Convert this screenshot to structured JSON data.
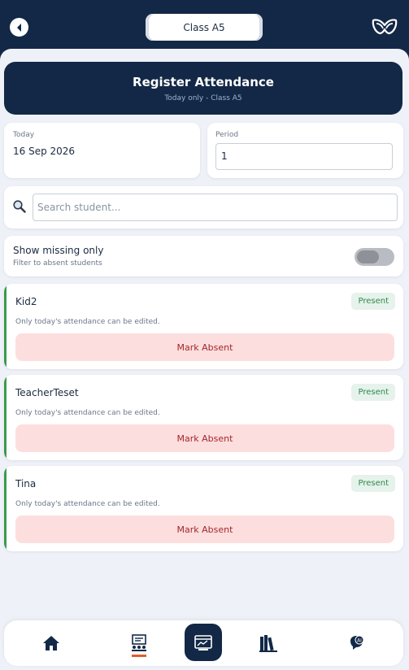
{
  "header": {
    "class_selector": "Class A5"
  },
  "hero": {
    "title": "Register Attendance",
    "subtitle": "Today only - Class A5"
  },
  "date_card": {
    "label": "Today",
    "value": "16 Sep 2026"
  },
  "period_card": {
    "label": "Period",
    "value": "1"
  },
  "search": {
    "placeholder": "Search student..."
  },
  "filter": {
    "title": "Show missing only",
    "subtitle": "Filter to absent students",
    "enabled": false
  },
  "students": [
    {
      "name": "Kid2",
      "status": "Present",
      "note": "Only today's attendance can be edited.",
      "action": "Mark Absent"
    },
    {
      "name": "TeacherTeset",
      "status": "Present",
      "note": "Only today's attendance can be edited.",
      "action": "Mark Absent"
    },
    {
      "name": "Tina",
      "status": "Present",
      "note": "Only today's attendance can be edited.",
      "action": "Mark Absent"
    }
  ],
  "bottom_nav": [
    {
      "icon": "home-icon"
    },
    {
      "icon": "class-register-icon"
    },
    {
      "icon": "dashboard-icon",
      "active": true
    },
    {
      "icon": "library-icon"
    },
    {
      "icon": "ai-chat-icon"
    }
  ],
  "colors": {
    "navy": "#132846",
    "background": "#eef1f7",
    "present_green": "#2e8a48",
    "absent_red": "#a3282c",
    "accent_orange": "#e25b2a"
  }
}
